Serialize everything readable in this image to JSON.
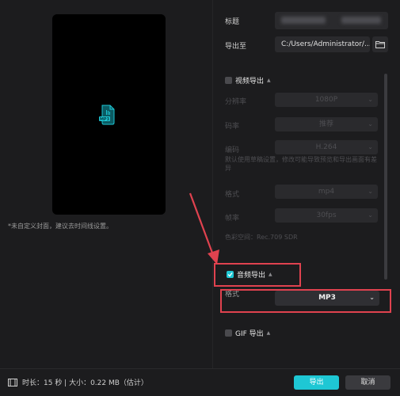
{
  "preview": {
    "file_badge": "MP3",
    "cover_hint": "*未自定义封面，建议去时间线设置。"
  },
  "form": {
    "title_label": "标题",
    "export_to_label": "导出至",
    "export_path": "C:/Users/Administrator/...",
    "video_export": {
      "label": "视频导出",
      "checked": false,
      "rows": [
        {
          "label": "分辨率",
          "value": "1080P"
        },
        {
          "label": "码率",
          "value": "推荐"
        },
        {
          "label": "编码",
          "value": "H.264"
        }
      ],
      "note": "默认使用草稿设置，修改可能导致预览和导出画面有差异",
      "rows2": [
        {
          "label": "格式",
          "value": "mp4"
        },
        {
          "label": "帧率",
          "value": "30fps"
        }
      ],
      "color_space": "色彩空间：Rec.709 SDR"
    },
    "audio_export": {
      "label": "音频导出",
      "checked": true,
      "format_label": "格式",
      "format_value": "MP3"
    },
    "gif_export": {
      "label": "GIF 导出",
      "checked": false
    }
  },
  "footer": {
    "info": "时长：15 秒 | 大小：0.22 MB（估计）",
    "export_button": "导出",
    "cancel_button": "取消"
  },
  "colors": {
    "accent": "#1ec7d4",
    "annotation": "#e0424f",
    "background": "#1c1c1e"
  }
}
